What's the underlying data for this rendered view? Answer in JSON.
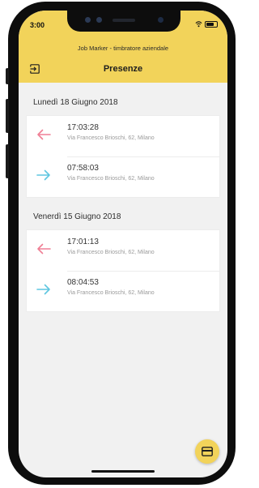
{
  "status_bar": {
    "time": "3:00"
  },
  "header": {
    "app_name": "Job Marker - timbratore aziendale",
    "title": "Presenze"
  },
  "sections": [
    {
      "date": "Lunedì 18 Giugno 2018",
      "entries": [
        {
          "direction": "out",
          "time": "17:03:28",
          "address": "Via Francesco Brioschi, 62, Milano"
        },
        {
          "direction": "in",
          "time": "07:58:03",
          "address": "Via Francesco Brioschi, 62, Milano"
        }
      ]
    },
    {
      "date": "Venerdì 15 Giugno 2018",
      "entries": [
        {
          "direction": "out",
          "time": "17:01:13",
          "address": "Via Francesco Brioschi, 62, Milano"
        },
        {
          "direction": "in",
          "time": "08:04:53",
          "address": "Via Francesco Brioschi, 62, Milano"
        }
      ]
    }
  ],
  "icons": {
    "logout": "logout-icon",
    "out_arrow": "arrow-left-icon",
    "in_arrow": "arrow-right-icon",
    "fab": "card-icon"
  },
  "colors": {
    "accent": "#f2d35a",
    "out_arrow": "#ef7f95",
    "in_arrow": "#5fc6e0"
  }
}
